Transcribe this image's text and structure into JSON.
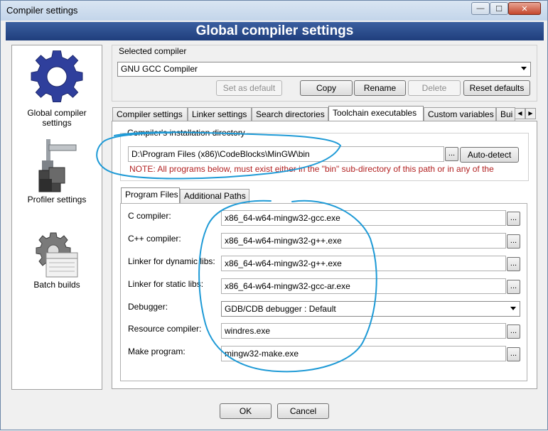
{
  "window": {
    "title": "Compiler settings",
    "minimize": "—",
    "maximize": "☐",
    "close": "✕"
  },
  "header": {
    "title": "Global compiler settings"
  },
  "sidebar": {
    "items": [
      {
        "label_line1": "Global compiler",
        "label_line2": "settings",
        "icon": "gear-icon"
      },
      {
        "label": "Profiler settings",
        "icon": "profiler-icon"
      },
      {
        "label": "Batch builds",
        "icon": "batch-builds-icon"
      }
    ]
  },
  "compiler_select": {
    "label": "Selected compiler",
    "value": "GNU GCC Compiler"
  },
  "compiler_buttons": {
    "set_default": "Set as default",
    "copy": "Copy",
    "rename": "Rename",
    "delete": "Delete",
    "reset_defaults": "Reset defaults"
  },
  "tabs": [
    "Compiler settings",
    "Linker settings",
    "Search directories",
    "Toolchain executables",
    "Custom variables",
    "Bui"
  ],
  "install_dir": {
    "label": "Compiler's installation directory",
    "value": "D:\\Program Files (x86)\\CodeBlocks\\MinGW\\bin",
    "browse": "...",
    "auto_detect": "Auto-detect",
    "note": "NOTE: All programs below, must exist either in the \"bin\" sub-directory of this path or in any of the"
  },
  "sub_tabs": [
    "Program Files",
    "Additional Paths"
  ],
  "programs": [
    {
      "label": "C compiler:",
      "value": "x86_64-w64-mingw32-gcc.exe",
      "type": "text"
    },
    {
      "label": "C++ compiler:",
      "value": "x86_64-w64-mingw32-g++.exe",
      "type": "text"
    },
    {
      "label": "Linker for dynamic libs:",
      "value": "x86_64-w64-mingw32-g++.exe",
      "type": "text"
    },
    {
      "label": "Linker for static libs:",
      "value": "x86_64-w64-mingw32-gcc-ar.exe",
      "type": "text"
    },
    {
      "label": "Debugger:",
      "value": "GDB/CDB debugger : Default",
      "type": "select"
    },
    {
      "label": "Resource compiler:",
      "value": "windres.exe",
      "type": "text"
    },
    {
      "label": "Make program:",
      "value": "mingw32-make.exe",
      "type": "text"
    }
  ],
  "browse_label": "...",
  "footer": {
    "ok": "OK",
    "cancel": "Cancel"
  },
  "colors": {
    "banner": "#1f3e7c",
    "note_text": "#b22222",
    "annotation": "#1e9ad6"
  }
}
